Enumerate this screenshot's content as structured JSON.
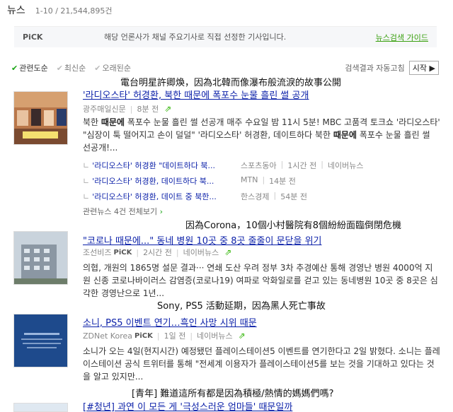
{
  "header": {
    "title": "뉴스",
    "count": "1-10 / 21,544,895건"
  },
  "pick": {
    "label": "PiCK",
    "desc": "해당 언론사가 채널 주요기사로 직접 선정한 기사입니다.",
    "guide": "뉴스검색 가이드"
  },
  "sort": {
    "options": [
      "관련도순",
      "최신순",
      "오래된순"
    ],
    "right_label": "검색결과 자동고침",
    "start": "시작 ▶"
  },
  "overlays": [
    "電台明星許卿煥，因為北韓而像瀑布般流淚的故事公開",
    "因為Corona，10個小村醫院有8個紛紛面臨倒閉危機",
    "Sony, PS5 活動延期，因為黑人死亡事故",
    "[青年] 難道這所有都是因為積極/熱情的媽媽們嗎?"
  ],
  "articles": [
    {
      "title": "'라디오스타' 허경환, 북한 때문에 폭포수 눈물 흘린 썰 공개",
      "source": "광주매일신문",
      "time": "8분 전",
      "desc": "북한 때문에 폭포수 눈물 흘린 썰 선공개 매주 수요일 밤 11시 5분! MBC 고품격 토크쇼 '라디오스타' \"심장이 툭 떨어지고 손이 덜덜\" '라디오스타' 허경환, 데이트하다 북한 때문에 폭포수 눈물 흘린 썰 선공개!...",
      "related": [
        {
          "title": "'라디오스타' 허경환 \"데이트하다 북...",
          "source": "스포츠동아",
          "time": "1시간 전",
          "extra": "네이버뉴스"
        },
        {
          "title": "'라디오스타' 허경환, 데이트하다 북...",
          "source": "MTN",
          "time": "14분 전",
          "extra": ""
        },
        {
          "title": "'라디오스타' 허경환, 데이트 중 북한...",
          "source": "한스경제",
          "time": "54분 전",
          "extra": ""
        }
      ],
      "more": "관련뉴스 4건 전체보기"
    },
    {
      "title": "\"코로나 때문에...\" 동네 병원 10곳 중 8곳 줄줄이 문닫을 위기",
      "source": "조선비즈",
      "pick": "PiCK",
      "time": "2시간 전",
      "extra": "네이버뉴스",
      "desc": "의협, 개원의 1865명 설문 결과··· 연쇄 도산 우려 정부 3차 추경예산 통해 경영난 병원 4000억 지원 신종 코로나바이러스 감염증(코로나19) 여파로 악화일로를 걷고 있는 동네병원 10곳 중 8곳은 심각한 경영난으로 1년..."
    },
    {
      "title": "소니, PS5 이벤트 연기…흑인 사망 시위 때문",
      "source": "ZDNet Korea",
      "pick": "PiCK",
      "time": "1일 전",
      "extra": "네이버뉴스",
      "desc": "소니가 오는 4일(현지시간) 예정됐던 플레이스테이션5 이벤트를 연기한다고 2일 밝혔다. 소니는 플레이스테이션 공식 트위터를 통해 \"전세계 이용자가 플레이스테이션5를 보는 것을 기대하고 있다는 것을 알고 있지만..."
    },
    {
      "title": "[#청년] 과연 이 모든 게 '극성스러운 엄마들' 때문일까"
    }
  ],
  "colors": {
    "link": "#0a1fa8",
    "green": "#19a514"
  }
}
